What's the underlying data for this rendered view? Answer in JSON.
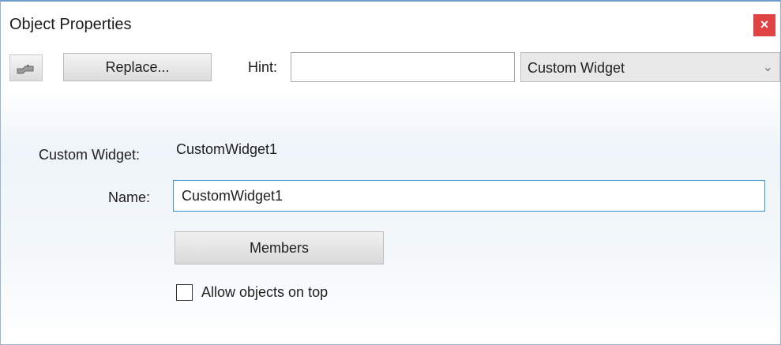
{
  "window": {
    "title": "Object Properties",
    "close_glyph": "×"
  },
  "toolbar": {
    "icon_name": "hand-pointer-icon",
    "replace_label": "Replace...",
    "hint_label": "Hint:",
    "hint_value": "",
    "type_selected": "Custom Widget",
    "chevron_glyph": "⌄"
  },
  "form": {
    "widget_label": "Custom Widget:",
    "widget_value": "CustomWidget1",
    "name_label": "Name:",
    "name_value": "CustomWidget1",
    "members_label": "Members",
    "allow_on_top_label": "Allow objects on top",
    "allow_on_top_checked": false
  },
  "colors": {
    "close_bg": "#e04343",
    "focus_border": "#3d8fd0",
    "title_border": "#6f9cc9"
  }
}
